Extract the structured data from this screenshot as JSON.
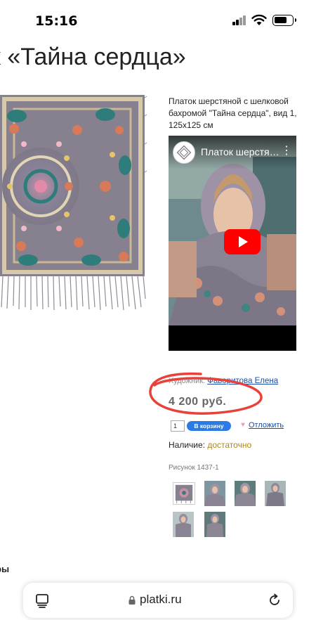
{
  "status": {
    "time": "15:16"
  },
  "page": {
    "title": "к «Тайна сердца»"
  },
  "product": {
    "description": "Платок шерстяной с шелковой бахромой \"Тайна сердца\", вид 1, 125x125 см",
    "artist_label": "Художник:",
    "artist_name": "Фаворитова Елена",
    "price": "4 200 руб.",
    "quantity": "1",
    "cart_label": "В корзину",
    "postpone_label": "Отложить",
    "availability_label": "Наличие:",
    "availability_value": "достаточно",
    "picture_id": "Рисунок 1437-1"
  },
  "video": {
    "title": "Платок шерстяной с шелковой бахромой \"Тайна сердца\""
  },
  "section": {
    "cut_heading": "ры"
  },
  "browser": {
    "url": "platki.ru"
  },
  "colors": {
    "accent": "#2c7be5",
    "link": "#1a4fa8",
    "highlight_circle": "#e8413a",
    "shawl": "#8d8795"
  }
}
